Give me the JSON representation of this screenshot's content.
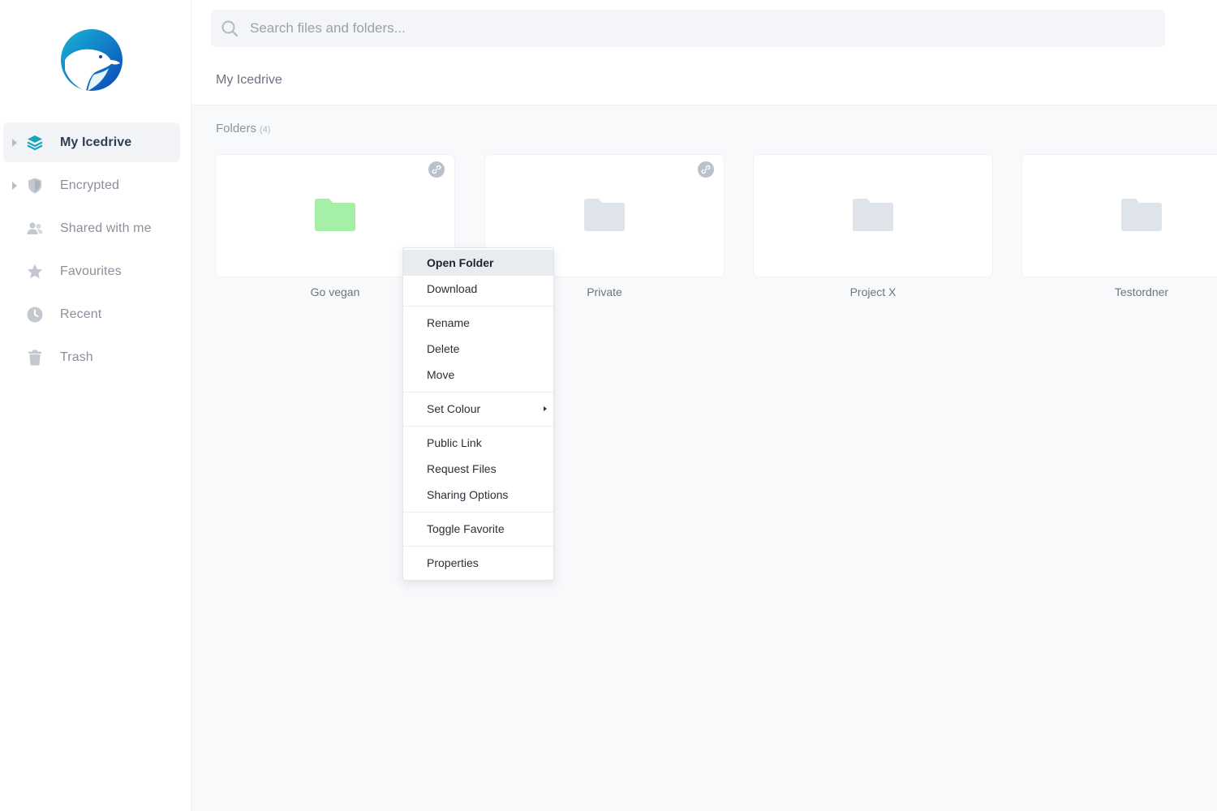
{
  "sidebar": {
    "items": [
      {
        "label": "My Icedrive",
        "icon": "layers-icon"
      },
      {
        "label": "Encrypted",
        "icon": "shield-icon"
      },
      {
        "label": "Shared with me",
        "icon": "users-icon"
      },
      {
        "label": "Favourites",
        "icon": "star-icon"
      },
      {
        "label": "Recent",
        "icon": "clock-icon"
      },
      {
        "label": "Trash",
        "icon": "trash-icon"
      }
    ]
  },
  "search": {
    "placeholder": "Search files and folders..."
  },
  "breadcrumb": "My Icedrive",
  "folders": {
    "title": "Folders",
    "count": "(4)",
    "items": [
      {
        "name": "Go vegan",
        "color": "#a5f0a6",
        "shared": true
      },
      {
        "name": "Private",
        "color": "#dfe3ea",
        "shared": true
      },
      {
        "name": "Project X",
        "color": "#dfe3ea",
        "shared": false
      },
      {
        "name": "Testordner",
        "color": "#dfe3ea",
        "shared": false
      }
    ]
  },
  "context_menu": {
    "groups": [
      [
        "Open Folder",
        "Download"
      ],
      [
        "Rename",
        "Delete",
        "Move"
      ],
      [
        "Set Colour"
      ],
      [
        "Public Link",
        "Request Files",
        "Sharing Options"
      ],
      [
        "Toggle Favorite"
      ],
      [
        "Properties"
      ]
    ]
  },
  "colors": {
    "accent": "#1aa6b7",
    "logo_blue": "#1565c0",
    "folder_green": "#a5f0a6",
    "folder_gray": "#dfe3ea"
  }
}
